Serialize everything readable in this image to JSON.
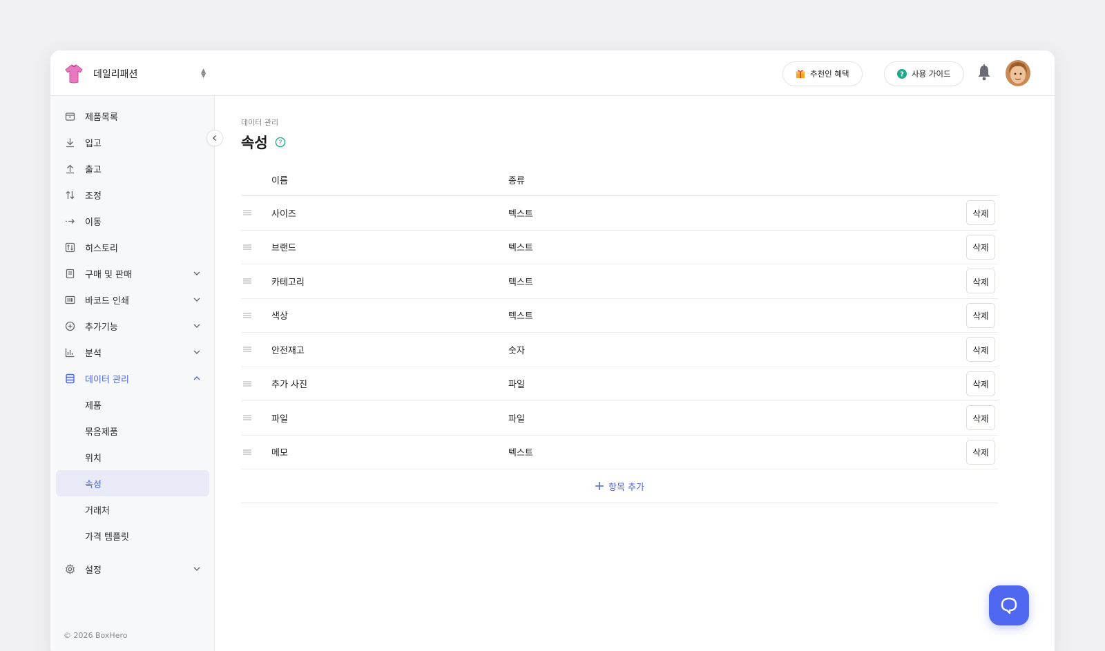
{
  "workspace": {
    "name": "데일리패션",
    "logo_icon": "tshirt-icon",
    "switch_icon": "updown-icon"
  },
  "header": {
    "referral_label": "추천인 혜택",
    "guide_label": "사용 가이드",
    "bell_icon": "bell-icon"
  },
  "sidebar": {
    "items": [
      {
        "label": "제품목록",
        "icon": "box-icon"
      },
      {
        "label": "입고",
        "icon": "download-icon"
      },
      {
        "label": "출고",
        "icon": "upload-icon"
      },
      {
        "label": "조정",
        "icon": "swap-icon"
      },
      {
        "label": "이동",
        "icon": "move-icon"
      },
      {
        "label": "히스토리",
        "icon": "history-icon"
      },
      {
        "label": "구매 및 판매",
        "icon": "document-icon"
      },
      {
        "label": "바코드 인쇄",
        "icon": "barcode-icon"
      },
      {
        "label": "추가기능",
        "icon": "plus-circle-icon"
      },
      {
        "label": "분석",
        "icon": "chart-icon"
      },
      {
        "label": "데이터 관리",
        "icon": "database-icon"
      }
    ],
    "sub_items": [
      {
        "label": "제품"
      },
      {
        "label": "묶음제품"
      },
      {
        "label": "위치"
      },
      {
        "label": "속성"
      },
      {
        "label": "거래처"
      },
      {
        "label": "가격 템플릿"
      }
    ],
    "settings_label": "설정",
    "copyright": "© 2026 BoxHero"
  },
  "page": {
    "breadcrumb": "데이터 관리",
    "title": "속성"
  },
  "table": {
    "headers": {
      "name": "이름",
      "type": "종류"
    },
    "rows": [
      {
        "name": "사이즈",
        "type": "텍스트"
      },
      {
        "name": "브랜드",
        "type": "텍스트"
      },
      {
        "name": "카테고리",
        "type": "텍스트"
      },
      {
        "name": "색상",
        "type": "텍스트"
      },
      {
        "name": "안전재고",
        "type": "숫자"
      },
      {
        "name": "추가 사진",
        "type": "파일"
      },
      {
        "name": "파일",
        "type": "파일"
      },
      {
        "name": "메모",
        "type": "텍스트"
      }
    ],
    "delete_label": "삭제",
    "add_label": "항목 추가"
  },
  "colors": {
    "accent": "#4f66d8",
    "chat": "#5068ef"
  }
}
